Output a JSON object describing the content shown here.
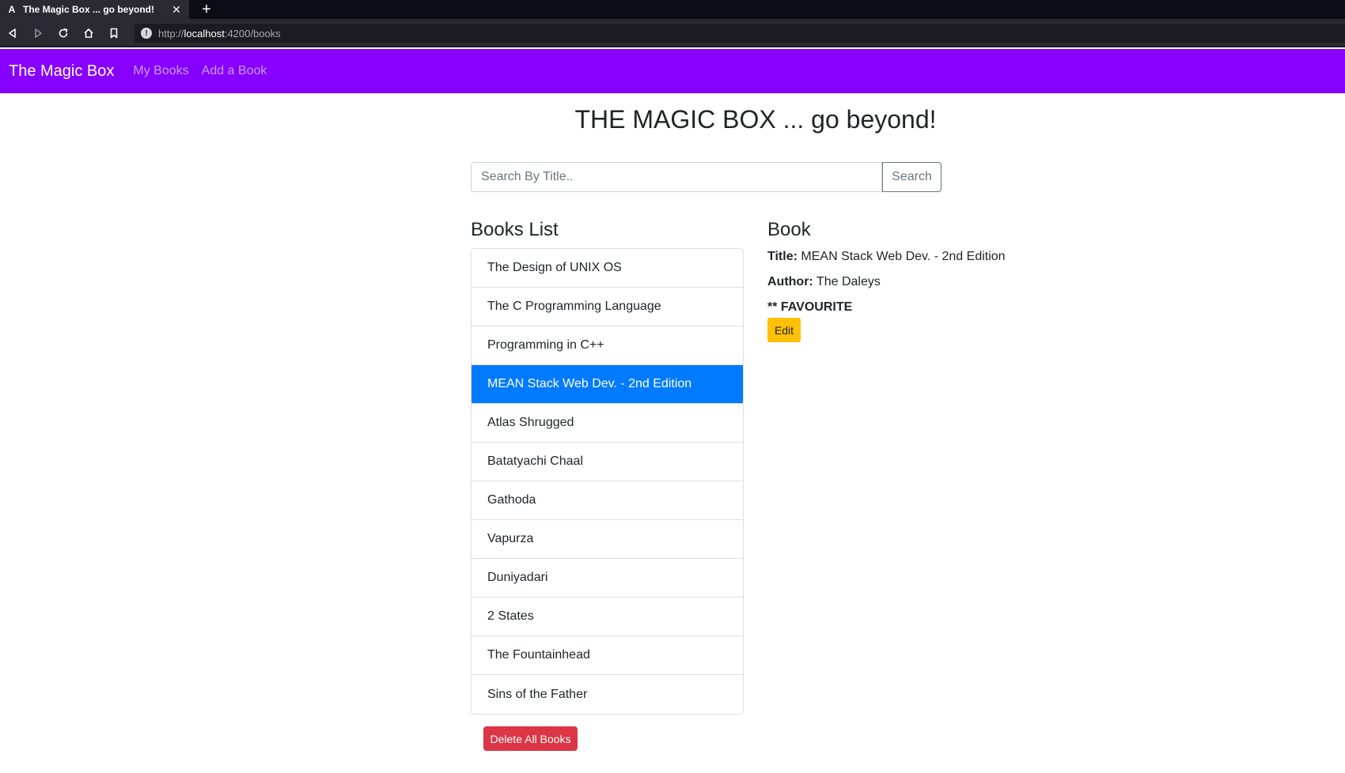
{
  "browser": {
    "tab_title": "The Magic Box ... go beyond!",
    "tab_favicon": "A",
    "url_prefix": "http://",
    "url_host": "localhost",
    "url_path": ":4200/books"
  },
  "navbar": {
    "brand": "The Magic Box",
    "links": [
      "My Books",
      "Add a Book"
    ],
    "color": "#8700fe"
  },
  "page": {
    "headline": "THE MAGIC BOX ... go beyond!"
  },
  "search": {
    "placeholder": "Search By Title..",
    "button_label": "Search"
  },
  "books_list": {
    "heading": "Books List",
    "items": [
      "The Design of UNIX OS",
      "The C Programming Language",
      "Programming in C++",
      "MEAN Stack Web Dev. - 2nd Edition",
      "Atlas Shrugged",
      "Batatyachi Chaal",
      "Gathoda",
      "Vapurza",
      "Duniyadari",
      "2 States",
      "The Fountainhead",
      "Sins of the Father"
    ],
    "selected_index": 3,
    "delete_all_label": "Delete All Books"
  },
  "book_detail": {
    "heading": "Book",
    "title_label": "Title:",
    "title_value": "MEAN Stack Web Dev. - 2nd Edition",
    "author_label": "Author:",
    "author_value": "The Daleys",
    "favourite_text": "** FAVOURITE",
    "edit_label": "Edit"
  }
}
